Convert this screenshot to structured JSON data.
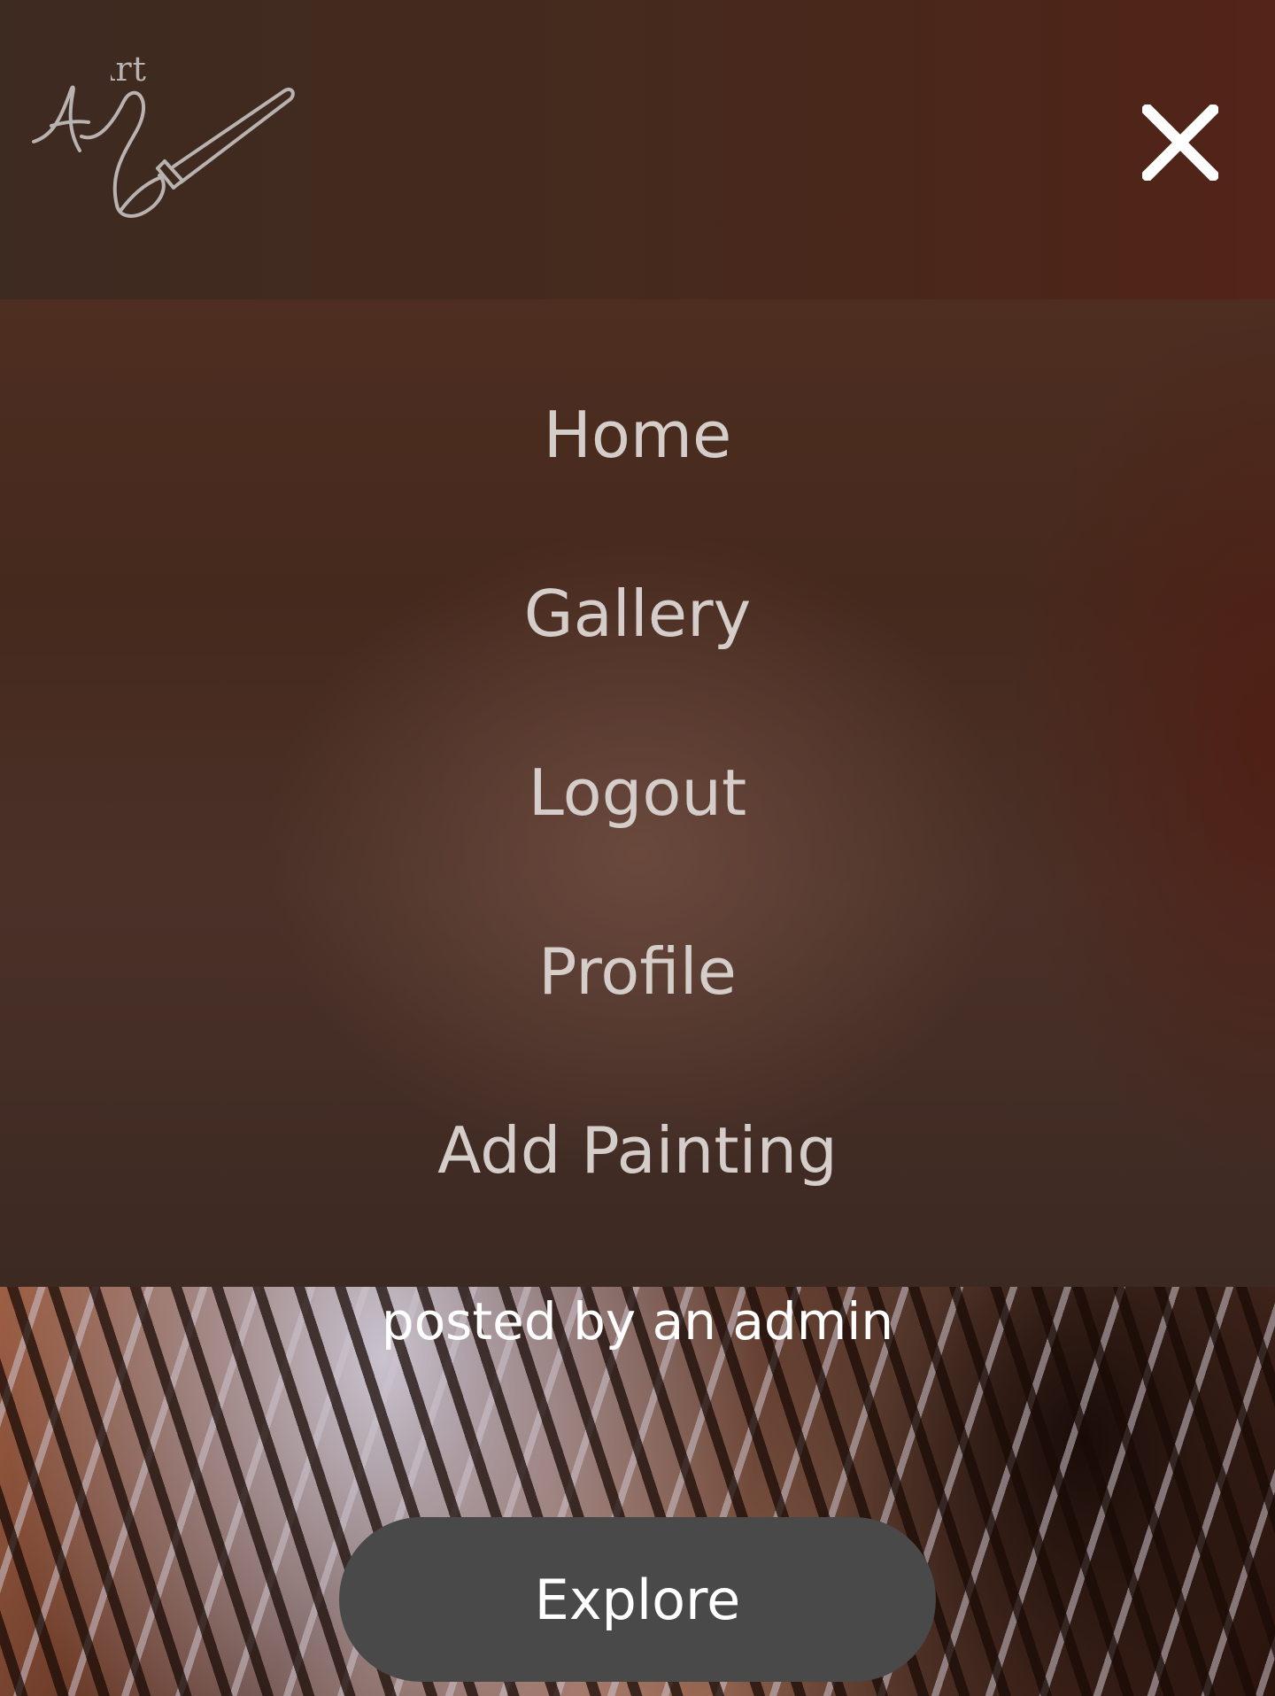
{
  "header": {
    "logo_icon": "art-paintbrush-logo",
    "logo_text": "Art",
    "close_icon": "close-x-icon"
  },
  "menu": {
    "items": [
      {
        "label": "Home"
      },
      {
        "label": "Gallery"
      },
      {
        "label": "Logout"
      },
      {
        "label": "Profile"
      },
      {
        "label": "Add Painting"
      }
    ]
  },
  "hero": {
    "posted_by": "posted by an admin",
    "explore_label": "Explore"
  },
  "colors": {
    "menu_text": "#d4cdca",
    "button_bg": "#494949",
    "white": "#ffffff"
  }
}
